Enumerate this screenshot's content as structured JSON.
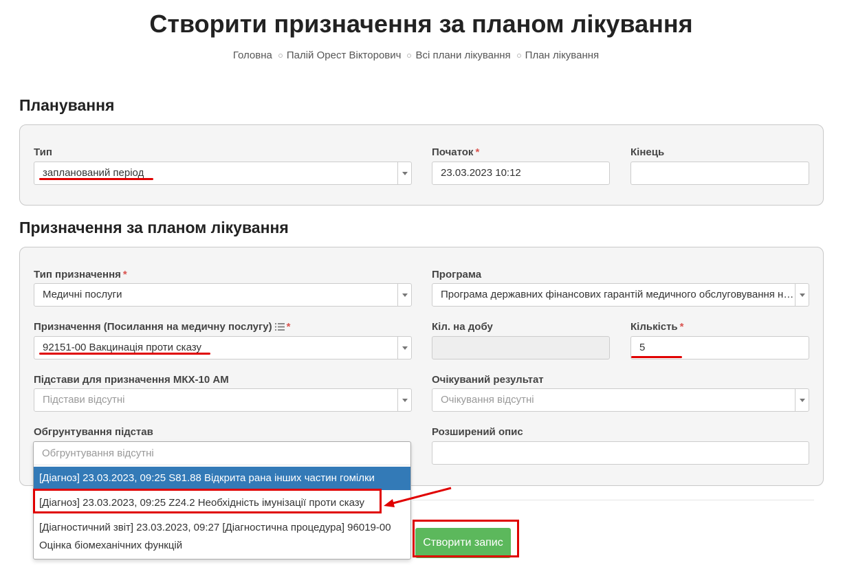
{
  "page": {
    "title": "Створити призначення за планом лікування"
  },
  "breadcrumb": [
    "Головна",
    "Палій Орест Вікторович",
    "Всі плани лікування",
    "План лікування"
  ],
  "planning": {
    "title": "Планування",
    "type_label": "Тип",
    "type_value": "запланований період",
    "start_label": "Початок",
    "start_value": "23.03.2023 10:12",
    "end_label": "Кінець",
    "end_value": ""
  },
  "appointment": {
    "title": "Призначення за планом лікування",
    "appointment_type_label": "Тип призначення",
    "appointment_type_value": "Медичні послуги",
    "program_label": "Програма",
    "program_value": "Програма державних фінансових гарантій медичного обслуговування населення",
    "service_label": "Призначення (Посилання на медичну послугу)",
    "service_value": "92151-00 Вакцинація проти сказу",
    "per_day_label": "Кіл. на добу",
    "per_day_value": "",
    "quantity_label": "Кількість",
    "quantity_value": "5",
    "reasons_label": "Підстави для призначення МКХ-10 АМ",
    "reasons_placeholder": "Підстави відсутні",
    "expected_result_label": "Очікуваний результат",
    "expected_result_placeholder": "Очікування відсутні",
    "justification_label": "Обгрунтування підстав",
    "justification_placeholder": "Обгрунтування відсутні",
    "extended_description_label": "Розширений опис",
    "extended_description_value": ""
  },
  "dropdown": {
    "options": [
      "[Діагноз] 23.03.2023, 09:25 S81.88 Відкрита рана інших частин гомілки",
      "[Діагноз] 23.03.2023, 09:25 Z24.2 Необхідність імунізації проти сказу",
      "[Діагностичний звіт] 23.03.2023, 09:27 [Діагностична процедура] 96019-00 Оцінка біомеханічних функцій"
    ]
  },
  "actions": {
    "create_label": "Створити запис"
  },
  "colors": {
    "accent_blue": "#337ab7",
    "button_green": "#5cb85c",
    "required_red": "#d9534f",
    "annotation_red": "#e00000"
  }
}
